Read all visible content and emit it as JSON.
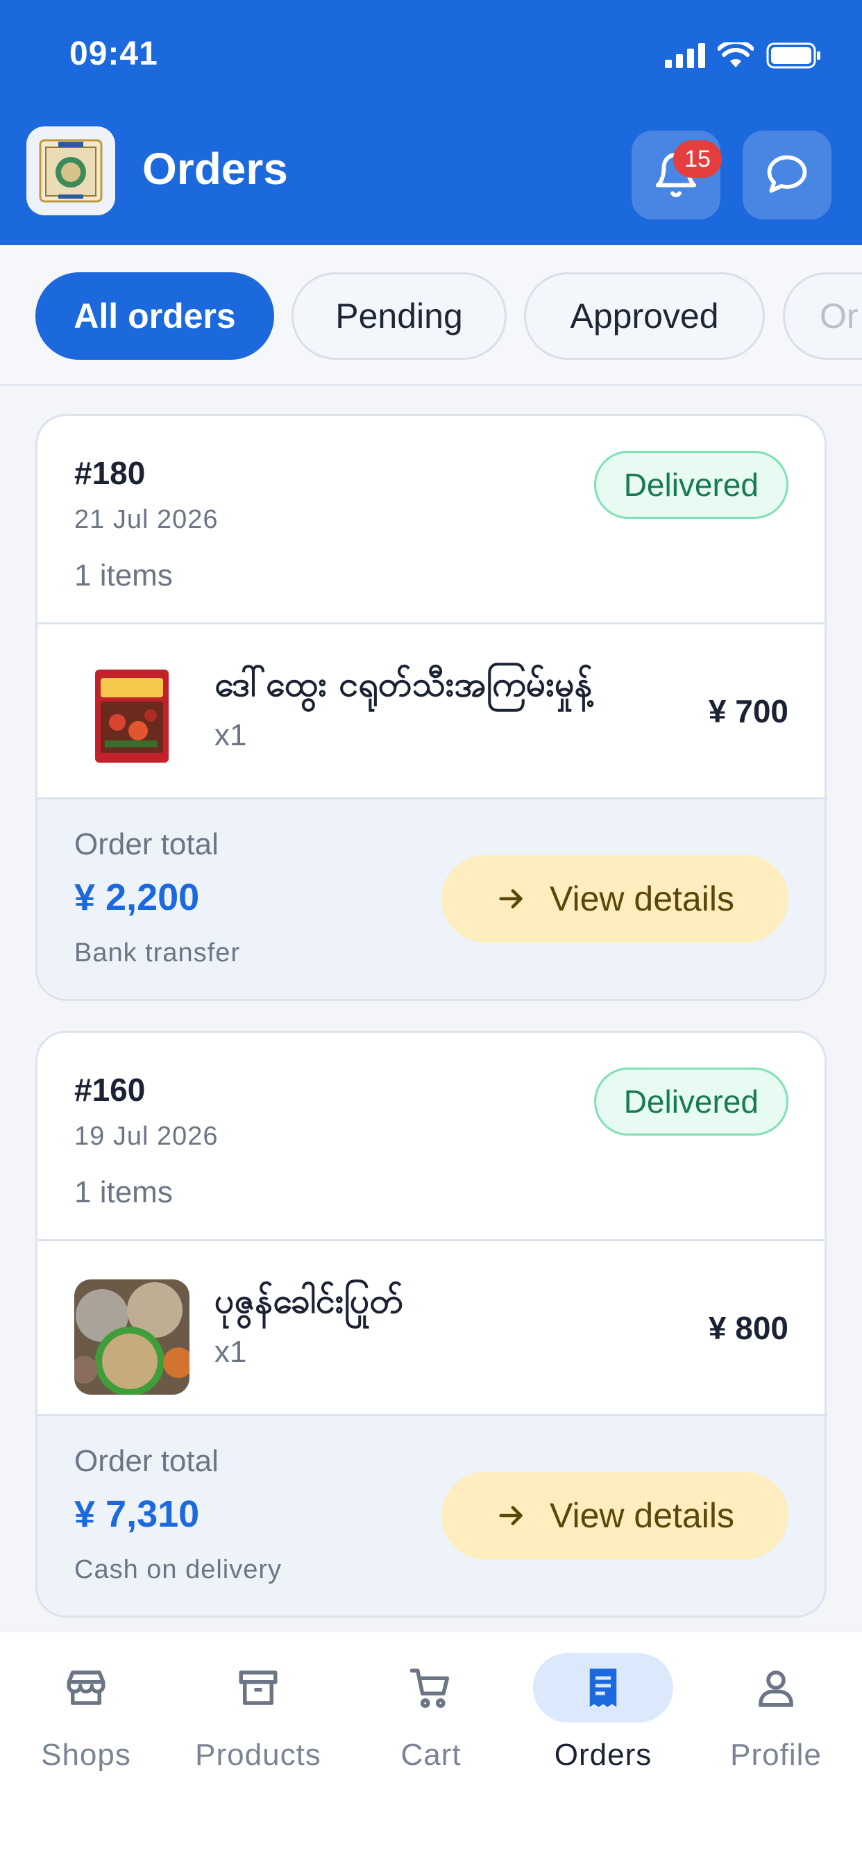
{
  "status_bar": {
    "time": "09:41"
  },
  "header": {
    "title": "Orders",
    "notifications_count": "15"
  },
  "filters": [
    {
      "label": "All orders",
      "active": true
    },
    {
      "label": "Pending",
      "active": false
    },
    {
      "label": "Approved",
      "active": false
    },
    {
      "label": "Or",
      "active": false
    }
  ],
  "orders": [
    {
      "id": "#180",
      "date": "21 Jul 2026",
      "item_count": "1 items",
      "status": "Delivered",
      "item": {
        "name": "ဒေါ်ထွေး ငရုတ်သီးအကြမ်းမှုန့်",
        "qty": "x1",
        "price": "¥ 700"
      },
      "total_label": "Order total",
      "total": "¥ 2,200",
      "payment": "Bank transfer",
      "action": "View details"
    },
    {
      "id": "#160",
      "date": "19 Jul 2026",
      "item_count": "1 items",
      "status": "Delivered",
      "item": {
        "name": "ပုဇွန်ခေါင်းပြုတ်",
        "qty": "x1",
        "price": "¥ 800"
      },
      "total_label": "Order total",
      "total": "¥ 7,310",
      "payment": "Cash on delivery",
      "action": "View details"
    }
  ],
  "nav": [
    {
      "label": "Shops",
      "icon": "store-icon",
      "active": false
    },
    {
      "label": "Products",
      "icon": "archive-box-icon",
      "active": false
    },
    {
      "label": "Cart",
      "icon": "cart-icon",
      "active": false
    },
    {
      "label": "Orders",
      "icon": "receipt-icon",
      "active": true
    },
    {
      "label": "Profile",
      "icon": "person-icon",
      "active": false
    }
  ],
  "colors": {
    "primary": "#1c68dd",
    "delivered": "#177a50",
    "view_button": "#fdedbf",
    "badge": "#e53e3e"
  }
}
